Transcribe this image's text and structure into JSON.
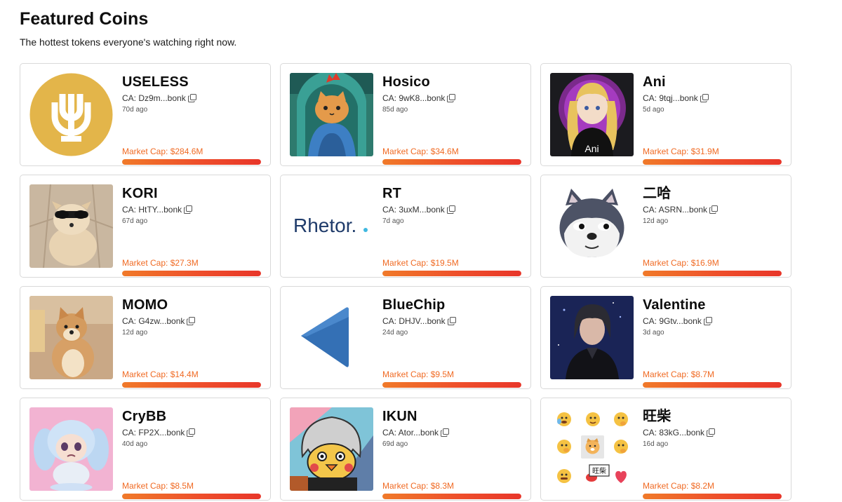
{
  "header": {
    "title": "Featured Coins",
    "subtitle": "The hottest tokens everyone's watching right now."
  },
  "coins": [
    {
      "name": "USELESS",
      "ca": "CA: Dz9m...bonk",
      "age": "70d ago",
      "market_cap": "Market Cap: $284.6M",
      "icon": "useless-logo",
      "progress": 1.0
    },
    {
      "name": "Hosico",
      "ca": "CA: 9wK8...bonk",
      "age": "85d ago",
      "market_cap": "Market Cap: $34.6M",
      "icon": "hosico-cat-image",
      "progress": 1.0
    },
    {
      "name": "Ani",
      "ca": "CA: 9tqj...bonk",
      "age": "5d ago",
      "market_cap": "Market Cap: $31.9M",
      "icon": "ani-anime-girl-image",
      "image_caption": "Ani",
      "progress": 1.0
    },
    {
      "name": "KORI",
      "ca": "CA: HtTY...bonk",
      "age": "67d ago",
      "market_cap": "Market Cap: $27.3M",
      "icon": "kori-dog-image",
      "progress": 1.0
    },
    {
      "name": "RT",
      "ca": "CA: 3uxM...bonk",
      "age": "7d ago",
      "market_cap": "Market Cap: $19.5M",
      "icon": "rhetor-logo",
      "logo_text": "Rhetor.",
      "progress": 1.0
    },
    {
      "name": "二哈",
      "ca": "CA: ASRN...bonk",
      "age": "12d ago",
      "market_cap": "Market Cap: $16.9M",
      "icon": "husky-emoji-image",
      "progress": 1.0
    },
    {
      "name": "MOMO",
      "ca": "CA: G4zw...bonk",
      "age": "12d ago",
      "market_cap": "Market Cap: $14.4M",
      "icon": "momo-shiba-image",
      "progress": 1.0
    },
    {
      "name": "BlueChip",
      "ca": "CA: DHJV...bonk",
      "age": "24d ago",
      "market_cap": "Market Cap: $9.5M",
      "icon": "bluechip-triangle-image",
      "progress": 1.0
    },
    {
      "name": "Valentine",
      "ca": "CA: 9Gtv...bonk",
      "age": "3d ago",
      "market_cap": "Market Cap: $8.7M",
      "icon": "valentine-character-image",
      "progress": 1.0
    },
    {
      "name": "CryBB",
      "ca": "CA: FP2X...bonk",
      "age": "40d ago",
      "market_cap": "Market Cap: $8.5M",
      "icon": "crybb-figure-image",
      "progress": 1.0
    },
    {
      "name": "IKUN",
      "ca": "CA: Ator...bonk",
      "age": "69d ago",
      "market_cap": "Market Cap: $8.3M",
      "icon": "ikun-chick-image",
      "progress": 1.0
    },
    {
      "name": "旺柴",
      "ca": "CA: 83kG...bonk",
      "age": "16d ago",
      "market_cap": "Market Cap: $8.2M",
      "icon": "wangchai-emoji-grid-image",
      "image_caption": "旺柴",
      "progress": 1.0
    }
  ],
  "colors": {
    "accent": "#f06a23",
    "bar_start": "#f07a2a",
    "bar_end": "#e8362a",
    "card_border": "#d9d9d9"
  }
}
